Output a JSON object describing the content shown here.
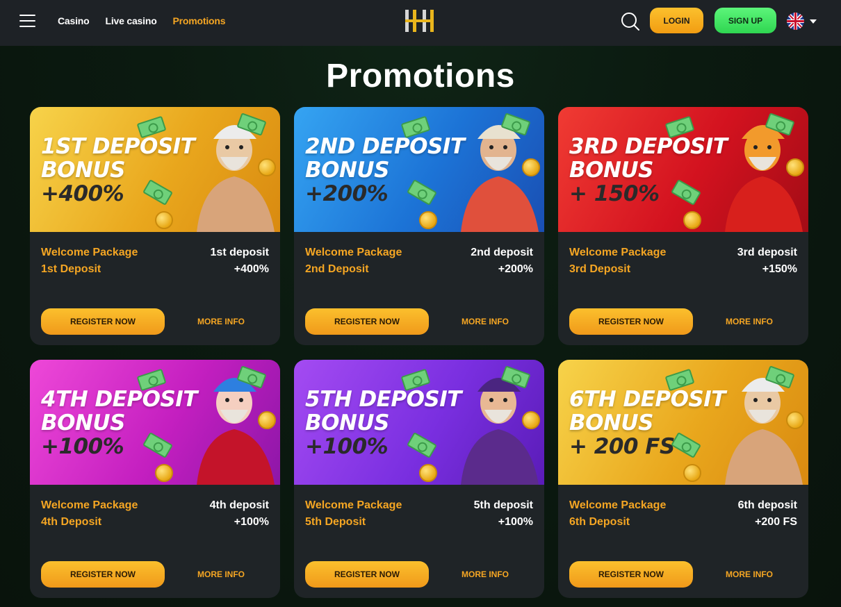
{
  "header": {
    "nav": [
      {
        "label": "Casino",
        "active": false
      },
      {
        "label": "Live casino",
        "active": false
      },
      {
        "label": "Promotions",
        "active": true
      }
    ],
    "login_label": "LOGIN",
    "signup_label": "SIGN UP",
    "language": "English (UK flag)"
  },
  "page": {
    "title": "Promotions"
  },
  "colors": {
    "accent": "#f5a623",
    "signup": "#3ee65f",
    "card_bg": "#1f2427",
    "header_bg": "#1e2226"
  },
  "promotions": [
    {
      "banner_line1": "1ST DEPOSIT",
      "banner_line2": "BONUS",
      "banner_amount": "+400%",
      "theme": "gold",
      "package": "Welcome Package",
      "package_sub": "1st Deposit",
      "deposit": "1st deposit",
      "bonus": "+400%",
      "register_label": "REGISTER NOW",
      "more_label": "MORE INFO"
    },
    {
      "banner_line1": "2ND DEPOSIT",
      "banner_line2": "BONUS",
      "banner_amount": "+200%",
      "theme": "blue",
      "package": "Welcome Package",
      "package_sub": "2nd Deposit",
      "deposit": "2nd deposit",
      "bonus": "+200%",
      "register_label": "REGISTER NOW",
      "more_label": "MORE INFO"
    },
    {
      "banner_line1": "3RD DEPOSIT",
      "banner_line2": "BONUS",
      "banner_amount": "+ 150%",
      "theme": "red",
      "package": "Welcome Package",
      "package_sub": "3rd Deposit",
      "deposit": "3rd deposit",
      "bonus": "+150%",
      "register_label": "REGISTER NOW",
      "more_label": "MORE INFO"
    },
    {
      "banner_line1": "4TH DEPOSIT",
      "banner_line2": "BONUS",
      "banner_amount": "+100%",
      "theme": "magenta",
      "package": "Welcome Package",
      "package_sub": "4th Deposit",
      "deposit": "4th deposit",
      "bonus": "+100%",
      "register_label": "REGISTER NOW",
      "more_label": "MORE INFO"
    },
    {
      "banner_line1": "5TH DEPOSIT",
      "banner_line2": "BONUS",
      "banner_amount": "+100%",
      "theme": "purple",
      "package": "Welcome Package",
      "package_sub": "5th Deposit",
      "deposit": "5th deposit",
      "bonus": "+100%",
      "register_label": "REGISTER NOW",
      "more_label": "MORE INFO"
    },
    {
      "banner_line1": "6TH DEPOSIT",
      "banner_line2": "BONUS",
      "banner_amount": "+ 200 FS",
      "theme": "gold",
      "package": "Welcome Package",
      "package_sub": "6th Deposit",
      "deposit": "6th deposit",
      "bonus": "+200 FS",
      "register_label": "REGISTER NOW",
      "more_label": "MORE INFO"
    }
  ]
}
